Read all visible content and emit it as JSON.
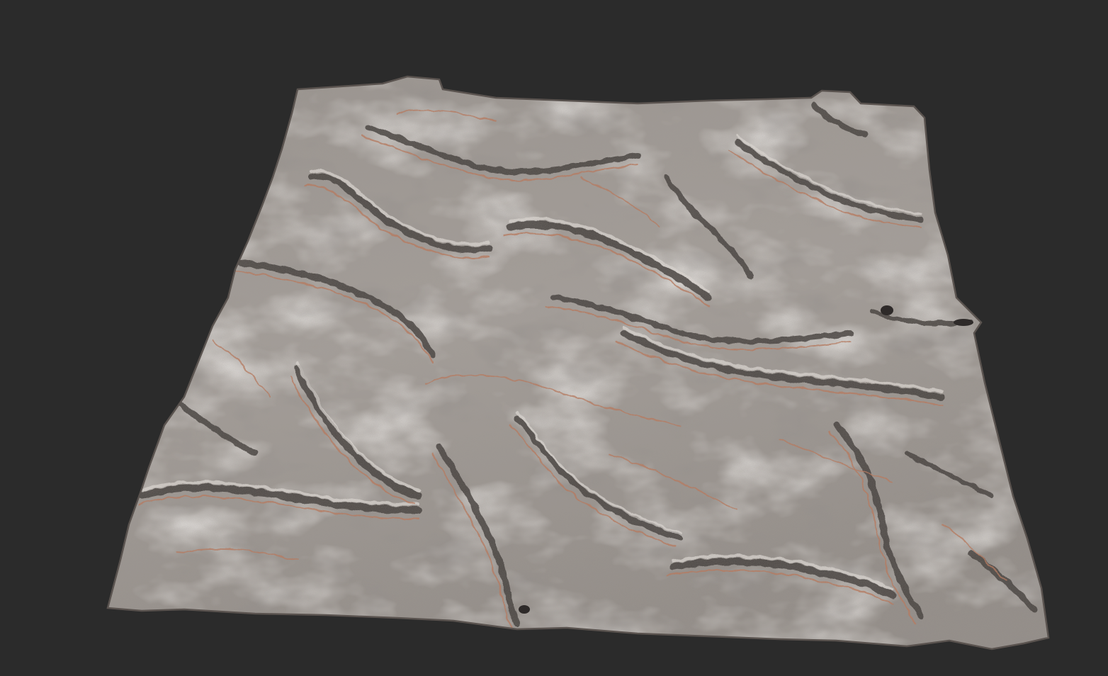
{
  "scene": {
    "subject": "terrain-heightmap-render",
    "background_color": "#2b2b2b",
    "colors": {
      "rock_base": "#8f8984",
      "rock_light": "#c9c3bd",
      "rock_highlight": "#e4e0dc",
      "rock_shadow": "#3d3938",
      "sediment_band": "#b9775a",
      "sediment_band_light": "#d49a7a",
      "edge_dark": "#5a534f"
    }
  }
}
